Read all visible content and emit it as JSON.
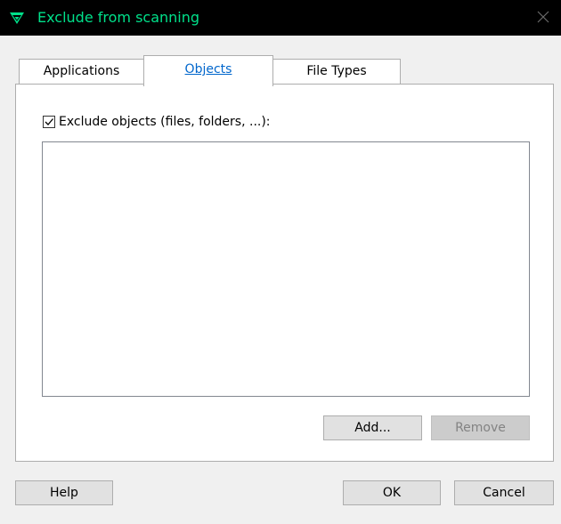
{
  "window": {
    "title": "Exclude from scanning",
    "close_icon": "close-icon",
    "app_icon": "shield-logo-icon",
    "accent_color": "#00e08a"
  },
  "tabs": [
    {
      "label": "Applications",
      "active": false
    },
    {
      "label": "Objects",
      "active": true
    },
    {
      "label": "File Types",
      "active": false
    }
  ],
  "objects_tab": {
    "checkbox_label": "Exclude objects (files, folders, ...):",
    "checkbox_checked": true,
    "objects_list": [],
    "add_label": "Add...",
    "remove_label": "Remove",
    "remove_enabled": false
  },
  "footer": {
    "help_label": "Help",
    "ok_label": "OK",
    "cancel_label": "Cancel"
  }
}
